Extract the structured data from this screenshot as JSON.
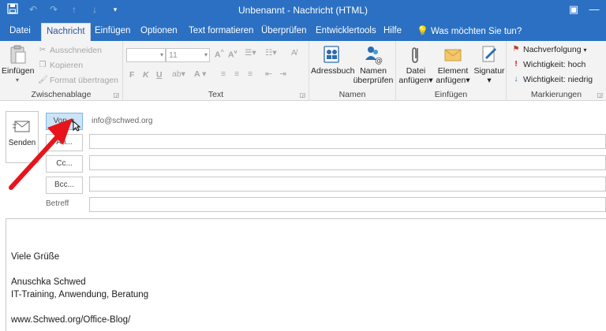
{
  "window": {
    "title": "Unbenannt  -  Nachricht (HTML)"
  },
  "tabs": [
    {
      "label": "Datei"
    },
    {
      "label": "Nachricht"
    },
    {
      "label": "Einfügen"
    },
    {
      "label": "Optionen"
    },
    {
      "label": "Text formatieren"
    },
    {
      "label": "Überprüfen"
    },
    {
      "label": "Entwicklertools"
    },
    {
      "label": "Hilfe"
    },
    {
      "label": "Was möchten Sie tun?"
    }
  ],
  "ribbon": {
    "clipboard": {
      "label": "Zwischenablage",
      "paste": "Einfügen",
      "cut": "Ausschneiden",
      "copy": "Kopieren",
      "format_painter": "Format übertragen"
    },
    "text": {
      "label": "Text",
      "font_size": "11",
      "bold": "F",
      "italic": "K",
      "underline": "U"
    },
    "names": {
      "label": "Namen",
      "address_book": "Adressbuch",
      "check_names_1": "Namen",
      "check_names_2": "überprüfen"
    },
    "insert": {
      "label": "Einfügen",
      "attach_file_1": "Datei",
      "attach_file_2": "anfügen",
      "attach_item_1": "Element",
      "attach_item_2": "anfügen",
      "signature": "Signatur"
    },
    "tags": {
      "label": "Markierungen",
      "follow_up": "Nachverfolgung",
      "high": "Wichtigkeit: hoch",
      "low": "Wichtigkeit: niedrig"
    }
  },
  "compose": {
    "send": "Senden",
    "from_button": "Von",
    "from_address": "info@schwed.org",
    "to_button": "An...",
    "cc_button": "Cc...",
    "bcc_button": "Bcc...",
    "subject_label": "Betreff",
    "body_lines": [
      "Viele Grüße",
      "Anuschka Schwed",
      "IT-Training, Anwendung, Beratung",
      "www.Schwed.org/Office-Blog/"
    ]
  },
  "colors": {
    "title_bar": "#2b70c2",
    "ribbon_bg": "#f3f3f3",
    "annotation_arrow": "#e8141b",
    "from_button_highlight": "#cce4f7"
  }
}
